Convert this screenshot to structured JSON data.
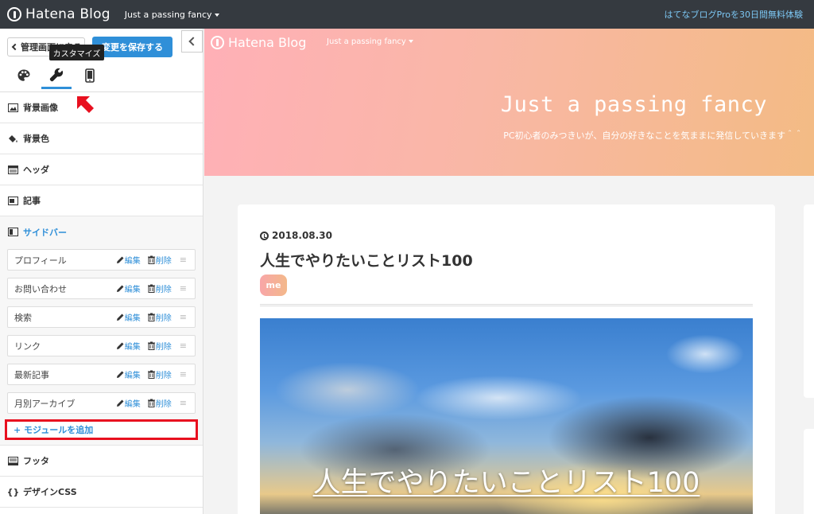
{
  "topbar": {
    "logo_text": "Hatena Blog",
    "blog_name": "Just a passing fancy",
    "promo": "はてなブログProを30日間無料体験"
  },
  "panel": {
    "back_label": "管理画面に戻る",
    "save_label": "変更を保存する",
    "tooltip": "カスタマイズ",
    "tabs": [
      "design-palette",
      "customize-wrench",
      "smartphone"
    ],
    "sections": [
      {
        "label": "背景画像",
        "icon": "image-icon"
      },
      {
        "label": "背景色",
        "icon": "paint-bucket-icon"
      },
      {
        "label": "ヘッダ",
        "icon": "layout-header-icon"
      },
      {
        "label": "記事",
        "icon": "layout-article-icon"
      },
      {
        "label": "サイドバー",
        "icon": "layout-sidebar-icon"
      },
      {
        "label": "フッタ",
        "icon": "layout-footer-icon"
      },
      {
        "label": "デザインCSS",
        "icon": "braces-icon"
      }
    ],
    "modules": [
      {
        "name": "プロフィール",
        "edit": "編集",
        "delete": "削除"
      },
      {
        "name": "お問い合わせ",
        "edit": "編集",
        "delete": "削除"
      },
      {
        "name": "検索",
        "edit": "編集",
        "delete": "削除"
      },
      {
        "name": "リンク",
        "edit": "編集",
        "delete": "削除"
      },
      {
        "name": "最新記事",
        "edit": "編集",
        "delete": "削除"
      },
      {
        "name": "月別アーカイブ",
        "edit": "編集",
        "delete": "削除"
      }
    ],
    "add_module": "+ モジュールを追加"
  },
  "preview": {
    "logo_text": "Hatena Blog",
    "blog_name": "Just a passing fancy",
    "hero_title": "Just a passing fancy",
    "hero_desc": "PC初心者のみつきいが、自分の好きなことを気ままに発信していきます＾＾",
    "post": {
      "date": "2018.08.30",
      "title": "人生でやりたいことリスト100",
      "category": "me",
      "eyecatch_title": "人生でやりたいことリスト100"
    }
  },
  "colors": {
    "topbar": "#353a40",
    "accent": "#2f8fd8",
    "annotation_red": "#e8101f",
    "promo": "#7cc6f2"
  }
}
